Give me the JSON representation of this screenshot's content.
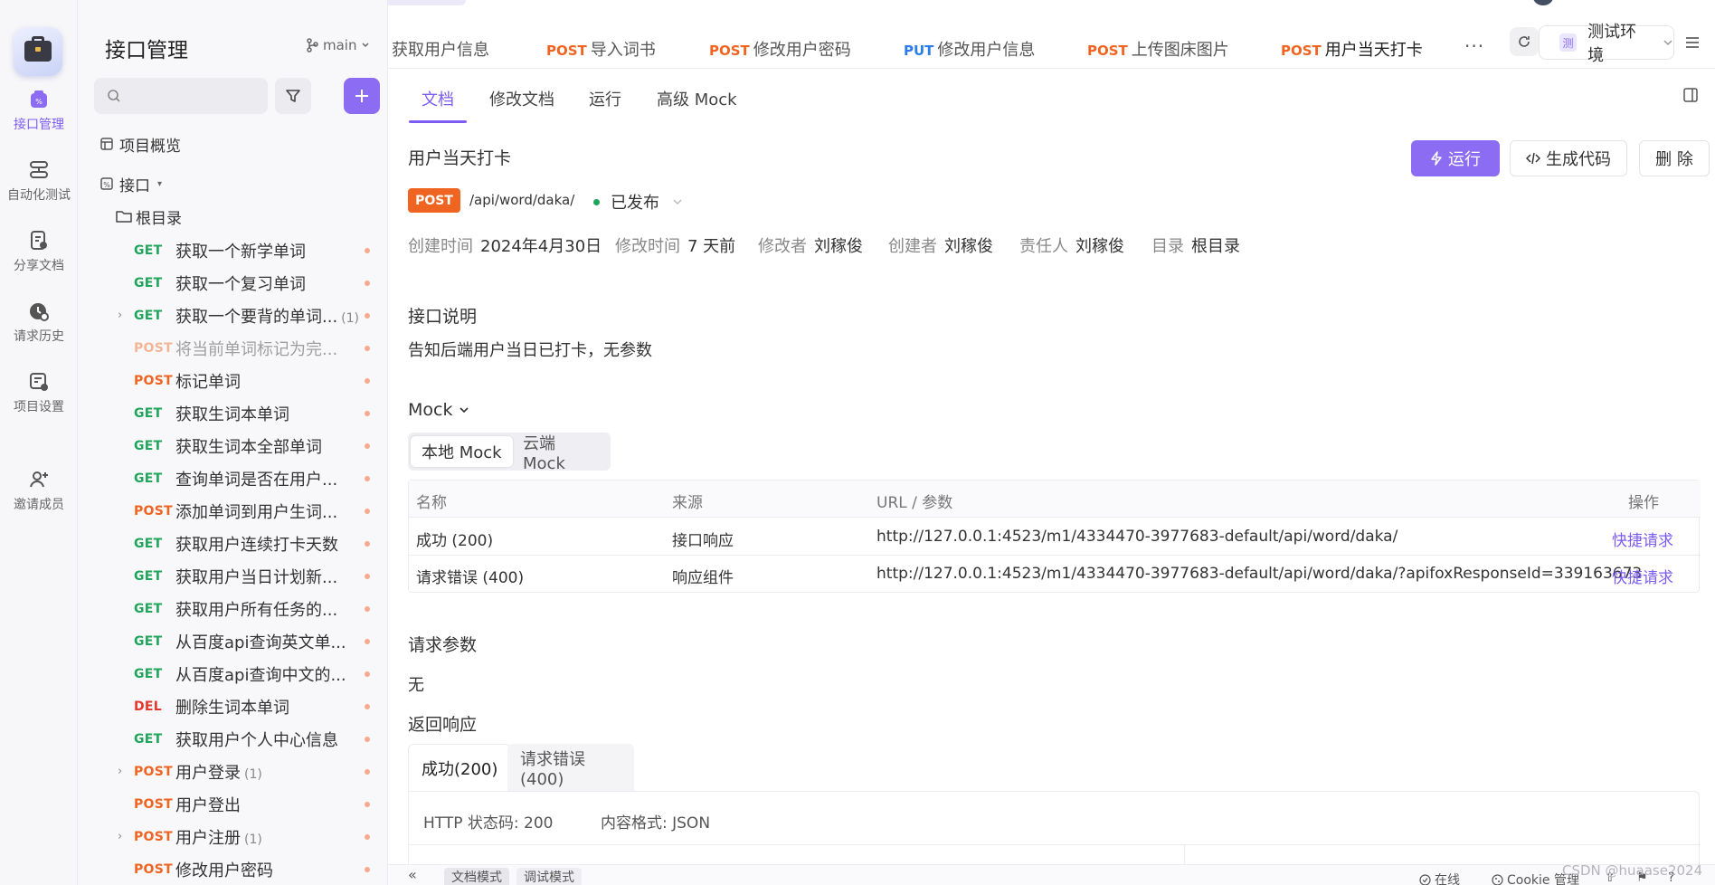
{
  "rail": {
    "items": [
      {
        "label": "接口管理",
        "icon": "api-icon"
      },
      {
        "label": "自动化测试",
        "icon": "automation-icon"
      },
      {
        "label": "分享文档",
        "icon": "share-doc-icon"
      },
      {
        "label": "请求历史",
        "icon": "history-icon"
      },
      {
        "label": "项目设置",
        "icon": "settings-icon"
      },
      {
        "label": "邀请成员",
        "icon": "invite-icon"
      }
    ]
  },
  "sidebar": {
    "title": "接口管理",
    "branch": "main",
    "overview": "项目概览",
    "api_group": "接口",
    "root_folder": "根目录",
    "endpoints": [
      {
        "method": "GET",
        "name": "获取一个新学单词",
        "count": "",
        "expandable": false
      },
      {
        "method": "GET",
        "name": "获取一个复习单词",
        "count": "",
        "expandable": false
      },
      {
        "method": "GET",
        "name": "获取一个要背的单词...",
        "count": "(1)",
        "expandable": true
      },
      {
        "method": "POST",
        "name": "将当前单词标记为完...",
        "count": "",
        "expandable": false,
        "muted": true
      },
      {
        "method": "POST",
        "name": "标记单词",
        "count": "",
        "expandable": false
      },
      {
        "method": "GET",
        "name": "获取生词本单词",
        "count": "",
        "expandable": false
      },
      {
        "method": "GET",
        "name": "获取生词本全部单词",
        "count": "",
        "expandable": false
      },
      {
        "method": "GET",
        "name": "查询单词是否在用户...",
        "count": "",
        "expandable": false
      },
      {
        "method": "POST",
        "name": "添加单词到用户生词...",
        "count": "",
        "expandable": false
      },
      {
        "method": "GET",
        "name": "获取用户连续打卡天数",
        "count": "",
        "expandable": false
      },
      {
        "method": "GET",
        "name": "获取用户当日计划新...",
        "count": "",
        "expandable": false
      },
      {
        "method": "GET",
        "name": "获取用户所有任务的...",
        "count": "",
        "expandable": false
      },
      {
        "method": "GET",
        "name": "从百度api查询英文单...",
        "count": "",
        "expandable": false
      },
      {
        "method": "GET",
        "name": "从百度api查询中文的...",
        "count": "",
        "expandable": false
      },
      {
        "method": "DEL",
        "name": "删除生词本单词",
        "count": "",
        "expandable": false
      },
      {
        "method": "GET",
        "name": "获取用户个人中心信息",
        "count": "",
        "expandable": false
      },
      {
        "method": "POST",
        "name": "用户登录",
        "count": "(1)",
        "expandable": true
      },
      {
        "method": "POST",
        "name": "用户登出",
        "count": "",
        "expandable": false
      },
      {
        "method": "POST",
        "name": "用户注册",
        "count": "(1)",
        "expandable": true
      },
      {
        "method": "POST",
        "name": "修改用户密码",
        "count": "",
        "expandable": false
      }
    ]
  },
  "tabs": [
    {
      "method": "",
      "label": "获取用户信息"
    },
    {
      "method": "POST",
      "label": "导入词书"
    },
    {
      "method": "POST",
      "label": "修改用户密码"
    },
    {
      "method": "PUT",
      "label": "修改用户信息"
    },
    {
      "method": "POST",
      "label": "上传图床图片"
    },
    {
      "method": "POST",
      "label": "用户当天打卡",
      "active": true
    }
  ],
  "tab_more": "···",
  "environment": {
    "badge": "测",
    "label": "测试环境"
  },
  "subtabs": [
    "文档",
    "修改文档",
    "运行",
    "高级 Mock"
  ],
  "doc": {
    "title": "用户当天打卡",
    "method": "POST",
    "path": "/api/word/daka/",
    "status": "已发布",
    "buttons": {
      "run": "运行",
      "gen_code": "生成代码",
      "delete": "删 除"
    },
    "meta": [
      {
        "label": "创建时间",
        "value": "2024年4月30日"
      },
      {
        "label": "修改时间",
        "value": "7 天前"
      },
      {
        "label": "修改者",
        "value": "刘稼俊"
      },
      {
        "label": "创建者",
        "value": "刘稼俊"
      },
      {
        "label": "责任人",
        "value": "刘稼俊"
      },
      {
        "label": "目录",
        "value": "根目录"
      }
    ],
    "desc_title": "接口说明",
    "desc": "告知后端用户当日已打卡，无参数",
    "mock_title": "Mock",
    "mock_options": [
      "本地 Mock",
      "云端 Mock"
    ],
    "mock_table": {
      "headers": [
        "名称",
        "来源",
        "URL / 参数",
        "操作"
      ],
      "rows": [
        {
          "name": "成功 (200)",
          "source": "接口响应",
          "url": "http://127.0.0.1:4523/m1/4334470-3977683-default/api/word/daka/",
          "action": "快捷请求"
        },
        {
          "name": "请求错误 (400)",
          "source": "响应组件",
          "url": "http://127.0.0.1:4523/m1/4334470-3977683-default/api/word/daka/?apifoxResponseId=339163673",
          "action": "快捷请求"
        }
      ]
    },
    "params_title": "请求参数",
    "params_none": "无",
    "response_title": "返回响应",
    "response_tabs": [
      "成功(200)",
      "请求错误(400)"
    ],
    "response_status": "HTTP 状态码: 200",
    "response_format": "内容格式: JSON"
  },
  "bottom": {
    "collapse": "«",
    "modes": [
      "文档模式",
      "调试模式"
    ],
    "online": "在线",
    "cookie": "Cookie 管理"
  },
  "watermark": "CSDN @huaase2024",
  "colors": {
    "accent": "#8b6cf2",
    "get": "#21a55b",
    "post": "#f06421",
    "put": "#2b7de9",
    "del": "#e5372c"
  }
}
